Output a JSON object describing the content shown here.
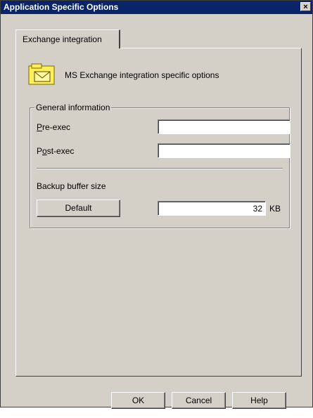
{
  "window": {
    "title": "Application Specific Options",
    "close_glyph": "×"
  },
  "tabs": [
    {
      "label": "Exchange integration",
      "selected": true
    }
  ],
  "header": {
    "icon": "envelope-folder-icon",
    "text": "MS Exchange integration specific options"
  },
  "group": {
    "legend": "General information",
    "pre_exec": {
      "label_first": "P",
      "label_rest": "re-exec",
      "value": ""
    },
    "post_exec": {
      "label_first": "P",
      "label_underlined": "o",
      "label_rest": "st-exec",
      "value": ""
    },
    "buffer": {
      "label": "Backup buffer size",
      "default_button": "Default",
      "value": "32",
      "unit": "KB"
    }
  },
  "buttons": {
    "ok": "OK",
    "cancel": "Cancel",
    "help": "Help"
  },
  "colors": {
    "title_bar": "#0a246a",
    "face": "#d4d0c8",
    "icon_fill": "#ffef5a"
  }
}
